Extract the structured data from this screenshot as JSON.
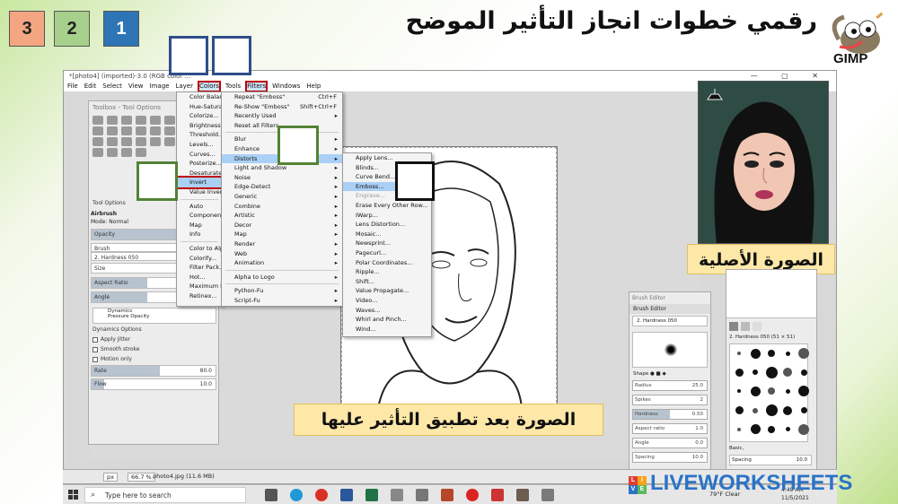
{
  "header": {
    "title": "رقمي خطوات انجاز التأثير الموضح",
    "gimp_label": "GIMP",
    "step_numbers": [
      "3",
      "2",
      "1"
    ],
    "step_colors": [
      "#f4a582",
      "#a8d08d",
      "#2e75b6"
    ]
  },
  "window": {
    "title": "*[photo4] (imported)-3.0 (RGB color ...",
    "controls": "— ▢ ✕"
  },
  "menubar": [
    "File",
    "Edit",
    "Select",
    "View",
    "Image",
    "Layer",
    "Colors",
    "Tools",
    "Filters",
    "Windows",
    "Help"
  ],
  "toolbox": {
    "title": "Toolbox - Tool Options",
    "tab": "Tool Options",
    "tool_name": "Airbrush",
    "mode": "Mode: Normal",
    "rows": [
      {
        "label": "Opacity",
        "value": "",
        "fill": 1.0
      },
      {
        "label": "Brush",
        "value": "",
        "fill": 0
      },
      {
        "label": "2. Hardness 050",
        "value": "",
        "fill": 0
      },
      {
        "label": "Size",
        "value": "",
        "fill": 0
      },
      {
        "label": "Aspect Ratio",
        "value": "",
        "fill": 0.45
      },
      {
        "label": "Angle",
        "value": "",
        "fill": 0.45
      }
    ],
    "dynamics_label": "Dynamics",
    "dynamics_value": "Pressure Opacity",
    "checks": [
      "Dynamics Options",
      "Apply Jitter",
      "Smooth stroke",
      "Motion only"
    ],
    "rate_label": "Rate",
    "rate_value": "80.0",
    "rate_fill": 0.55,
    "flow_label": "Flow",
    "flow_value": "10.0",
    "flow_fill": 0.1
  },
  "colors_menu": [
    {
      "label": "Color Balance...",
      "sel": false
    },
    {
      "label": "Hue-Saturation...",
      "sel": false
    },
    {
      "label": "Colorize...",
      "sel": false
    },
    {
      "label": "Brightness-Contrast...",
      "sel": false
    },
    {
      "label": "Threshold...",
      "sel": false
    },
    {
      "label": "Levels...",
      "sel": false
    },
    {
      "label": "Curves...",
      "sel": false
    },
    {
      "label": "Posterize...",
      "sel": false
    },
    {
      "label": "Desaturate",
      "sel": false
    },
    {
      "label": "Invert",
      "sel": true
    },
    {
      "label": "Value Invert",
      "sel": false
    },
    {
      "label": "Auto",
      "sel": false
    },
    {
      "label": "Components",
      "sel": false
    },
    {
      "label": "Map",
      "sel": false
    },
    {
      "label": "Info",
      "sel": false
    },
    {
      "label": "Color to Alpha...",
      "sel": false
    },
    {
      "label": "Colorify...",
      "sel": false
    },
    {
      "label": "Filter Pack...",
      "sel": false
    },
    {
      "label": "Hot...",
      "sel": false
    },
    {
      "label": "Maximum RGB...",
      "sel": false
    },
    {
      "label": "Retinex...",
      "sel": false
    }
  ],
  "filters_menu": [
    {
      "label": "Repeat \"Emboss\"",
      "sc": "Ctrl+F",
      "arr": false,
      "sel": false
    },
    {
      "label": "Re-Show \"Emboss\"",
      "sc": "Shift+Ctrl+F",
      "arr": false,
      "sel": false
    },
    {
      "label": "Recently Used",
      "sc": "",
      "arr": true,
      "sel": false
    },
    {
      "label": "Reset all Filters",
      "sc": "",
      "arr": false,
      "sel": false
    },
    {
      "label": "Blur",
      "sc": "",
      "arr": true,
      "sel": false
    },
    {
      "label": "Enhance",
      "sc": "",
      "arr": true,
      "sel": false
    },
    {
      "label": "Distorts",
      "sc": "",
      "arr": true,
      "sel": true
    },
    {
      "label": "Light and Shadow",
      "sc": "",
      "arr": true,
      "sel": false
    },
    {
      "label": "Noise",
      "sc": "",
      "arr": true,
      "sel": false
    },
    {
      "label": "Edge-Detect",
      "sc": "",
      "arr": true,
      "sel": false
    },
    {
      "label": "Generic",
      "sc": "",
      "arr": true,
      "sel": false
    },
    {
      "label": "Combine",
      "sc": "",
      "arr": true,
      "sel": false
    },
    {
      "label": "Artistic",
      "sc": "",
      "arr": true,
      "sel": false
    },
    {
      "label": "Decor",
      "sc": "",
      "arr": true,
      "sel": false
    },
    {
      "label": "Map",
      "sc": "",
      "arr": true,
      "sel": false
    },
    {
      "label": "Render",
      "sc": "",
      "arr": true,
      "sel": false
    },
    {
      "label": "Web",
      "sc": "",
      "arr": true,
      "sel": false
    },
    {
      "label": "Animation",
      "sc": "",
      "arr": true,
      "sel": false
    },
    {
      "label": "Alpha to Logo",
      "sc": "",
      "arr": true,
      "sel": false
    },
    {
      "label": "Python-Fu",
      "sc": "",
      "arr": true,
      "sel": false
    },
    {
      "label": "Script-Fu",
      "sc": "",
      "arr": true,
      "sel": false
    }
  ],
  "distorts_menu": [
    {
      "label": "Apply Lens...",
      "sel": false,
      "dim": false
    },
    {
      "label": "Blinds...",
      "sel": false,
      "dim": false
    },
    {
      "label": "Curve Bend...",
      "sel": false,
      "dim": false
    },
    {
      "label": "Emboss...",
      "sel": true,
      "dim": false
    },
    {
      "label": "Engrave...",
      "sel": false,
      "dim": true
    },
    {
      "label": "Erase Every Other Row...",
      "sel": false,
      "dim": false
    },
    {
      "label": "IWarp...",
      "sel": false,
      "dim": false
    },
    {
      "label": "Lens Distortion...",
      "sel": false,
      "dim": false
    },
    {
      "label": "Mosaic...",
      "sel": false,
      "dim": false
    },
    {
      "label": "Newsprint...",
      "sel": false,
      "dim": false
    },
    {
      "label": "Pagecurl...",
      "sel": false,
      "dim": false
    },
    {
      "label": "Polar Coordinates...",
      "sel": false,
      "dim": false
    },
    {
      "label": "Ripple...",
      "sel": false,
      "dim": false
    },
    {
      "label": "Shift...",
      "sel": false,
      "dim": false
    },
    {
      "label": "Value Propagate...",
      "sel": false,
      "dim": false
    },
    {
      "label": "Video...",
      "sel": false,
      "dim": false
    },
    {
      "label": "Waves...",
      "sel": false,
      "dim": false
    },
    {
      "label": "Whirl and Pinch...",
      "sel": false,
      "dim": false
    },
    {
      "label": "Wind...",
      "sel": false,
      "dim": false
    }
  ],
  "captions": {
    "original": "الصورة الأصلية",
    "after": "الصورة بعد تطبيق التأثير عليها"
  },
  "brush_editor": {
    "title": "Brush Editor",
    "tab": "Brush Editor",
    "brush_name": "2. Hardness 050",
    "shape_label": "Shape",
    "rows": [
      {
        "label": "Radius",
        "value": "25.0",
        "fill": 0
      },
      {
        "label": "Spikes",
        "value": "2",
        "fill": 0
      },
      {
        "label": "Hardness",
        "value": "0.50",
        "fill": 0.5
      },
      {
        "label": "Aspect ratio",
        "value": "1.0",
        "fill": 0
      },
      {
        "label": "Angle",
        "value": "0.0",
        "fill": 0
      },
      {
        "label": "Spacing",
        "value": "10.0",
        "fill": 0
      }
    ]
  },
  "brushes_panel": {
    "brush_label": "2. Hardness 050 (51 × 51)",
    "preset": "Basic,",
    "spacing_label": "Spacing",
    "spacing_value": "10.0"
  },
  "statusbar": {
    "unit": "px",
    "zoom": "66.7 %",
    "file": "photo4.jpg (11.6 MB)"
  },
  "taskbar": {
    "search_placeholder": "Type here to search",
    "weather": "79°F Clear",
    "time": "4:49 AM",
    "date": "11/5/2021"
  },
  "watermark": {
    "badge_letters": [
      "L",
      "I",
      "V",
      "E"
    ],
    "badge_colors": [
      "#e03c31",
      "#f7a21b",
      "#2b73c7",
      "#5cb85c"
    ],
    "text": "LIVEWORKSHEETS"
  }
}
